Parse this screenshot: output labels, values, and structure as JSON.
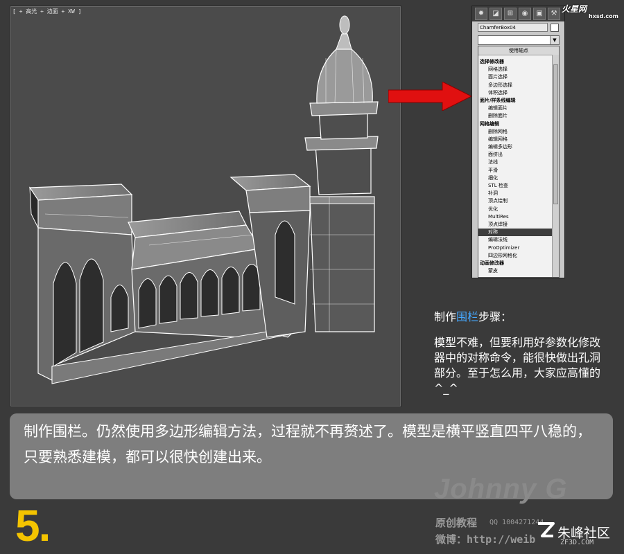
{
  "viewport": {
    "label": "[ + 高光 + 边面 + XW ]"
  },
  "command_panel": {
    "tab_icons": [
      "sun-icon",
      "bend-icon",
      "hierarchy-icon",
      "motion-icon",
      "display-icon",
      "utility-icon"
    ],
    "object_name": "ChamferBox04",
    "object_color": "#ffffff",
    "dropdown_header": "使用轴点",
    "items": [
      {
        "label": "选择修改器",
        "kind": "cat"
      },
      {
        "label": "网格选择",
        "kind": "sub"
      },
      {
        "label": "面片选择",
        "kind": "sub"
      },
      {
        "label": "多边形选择",
        "kind": "sub"
      },
      {
        "label": "体积选择",
        "kind": "sub"
      },
      {
        "label": "面片/样条线编辑",
        "kind": "cat"
      },
      {
        "label": "编辑面片",
        "kind": "sub"
      },
      {
        "label": "删除面片",
        "kind": "sub"
      },
      {
        "label": "网格编辑",
        "kind": "cat"
      },
      {
        "label": "删除网格",
        "kind": "sub"
      },
      {
        "label": "编辑网格",
        "kind": "sub"
      },
      {
        "label": "编辑多边形",
        "kind": "sub"
      },
      {
        "label": "面挤出",
        "kind": "sub"
      },
      {
        "label": "法线",
        "kind": "sub"
      },
      {
        "label": "平滑",
        "kind": "sub"
      },
      {
        "label": "细化",
        "kind": "sub"
      },
      {
        "label": "STL 检查",
        "kind": "sub"
      },
      {
        "label": "补洞",
        "kind": "sub"
      },
      {
        "label": "顶点绘制",
        "kind": "sub"
      },
      {
        "label": "优化",
        "kind": "sub"
      },
      {
        "label": "MultiRes",
        "kind": "sub"
      },
      {
        "label": "顶点焊接",
        "kind": "sub"
      },
      {
        "label": "对称",
        "kind": "sub",
        "selected": true
      },
      {
        "label": "编辑法线",
        "kind": "sub"
      },
      {
        "label": "ProOptimizer",
        "kind": "sub"
      },
      {
        "label": "四边形网格化",
        "kind": "sub"
      },
      {
        "label": "动画修改器",
        "kind": "cat"
      },
      {
        "label": "蒙皮",
        "kind": "sub"
      }
    ]
  },
  "watermark_top": {
    "name": "火星网",
    "url": "hxsd.com"
  },
  "side_note": {
    "title_pre": "制作",
    "title_highlight": "围栏",
    "title_post": "步骤：",
    "body": "模型不难，但要利用好参数化修改器中的对称命令，能很快做出孔洞部分。至于怎么用，大家应高懂的^_^"
  },
  "description": "制作围栏。仍然使用多边形编辑方法，过程就不再赘述了。模型是横平竖直四平八稳的，只要熟悉建模，都可以很快创建出来。",
  "step_number": "5.",
  "signature": {
    "name": "Johnny G",
    "subtitle": "原创教程",
    "qq": "QQ 1004271244",
    "weibo": "微博：http://weib"
  },
  "zf": {
    "name": "朱峰社区",
    "url": "ZF3D.COM"
  },
  "colors": {
    "highlight": "#45a8ff",
    "step": "#f4c400",
    "arrow": "#e01010",
    "selected_item": "#3d3d3d"
  }
}
